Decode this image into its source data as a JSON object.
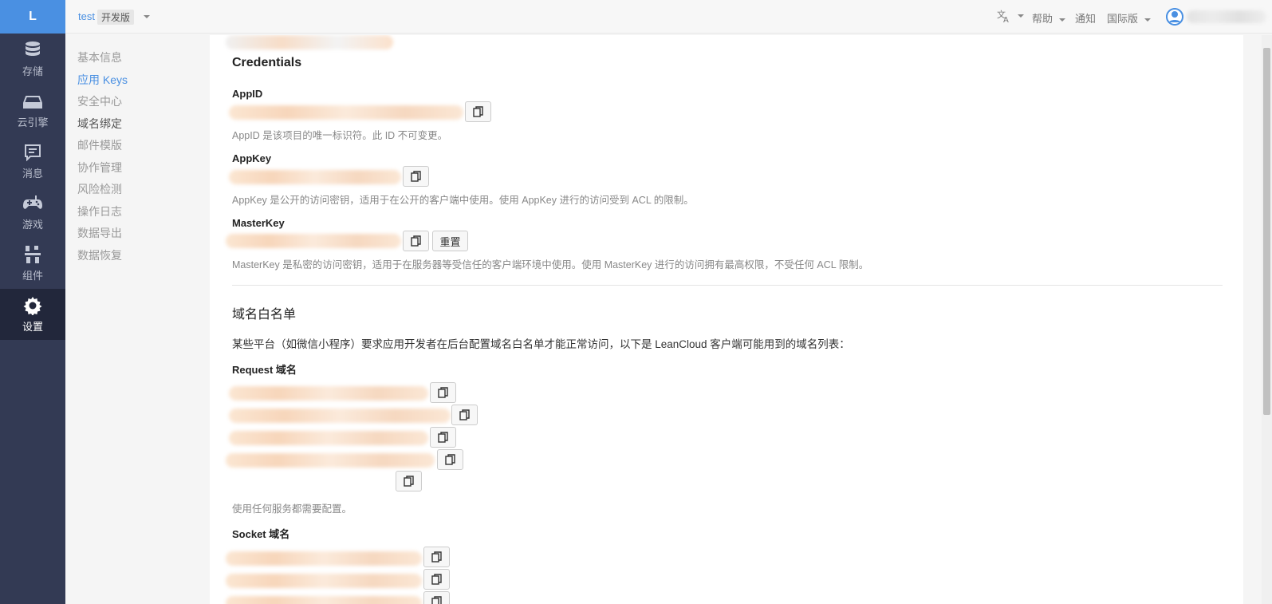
{
  "logo": {
    "letter": "L"
  },
  "nav": {
    "items": [
      {
        "label": "存储",
        "icon": "database-icon"
      },
      {
        "label": "云引擎",
        "icon": "server-icon"
      },
      {
        "label": "消息",
        "icon": "message-icon"
      },
      {
        "label": "游戏",
        "icon": "gamepad-icon"
      },
      {
        "label": "组件",
        "icon": "components-icon"
      },
      {
        "label": "设置",
        "icon": "gear-icon",
        "active": true
      }
    ]
  },
  "topbar": {
    "app_name": "test",
    "env": "开发版",
    "language_icon": "translate-icon",
    "help": "帮助",
    "notify": "通知",
    "region": "国际版"
  },
  "submenu": {
    "items": [
      {
        "label": "基本信息"
      },
      {
        "label": "应用 Keys",
        "active": true
      },
      {
        "label": "安全中心"
      },
      {
        "label": "域名绑定"
      },
      {
        "label": "邮件模版"
      },
      {
        "label": "协作管理"
      },
      {
        "label": "风险检测"
      },
      {
        "label": "操作日志"
      },
      {
        "label": "数据导出"
      },
      {
        "label": "数据恢复"
      }
    ]
  },
  "credentials": {
    "title": "Credentials",
    "appid": {
      "label": "AppID",
      "desc": "AppID 是该项目的唯一标识符。此 ID 不可变更。"
    },
    "appkey": {
      "label": "AppKey",
      "desc": "AppKey 是公开的访问密钥，适用于在公开的客户端中使用。使用 AppKey 进行的访问受到 ACL 的限制。"
    },
    "masterkey": {
      "label": "MasterKey",
      "reset": "重置",
      "desc": "MasterKey 是私密的访问密钥，适用于在服务器等受信任的客户端环境中使用。使用 MasterKey 进行的访问拥有最高权限，不受任何 ACL 限制。"
    }
  },
  "whitelist": {
    "title": "域名白名单",
    "intro": "某些平台（如微信小程序）要求应用开发者在后台配置域名白名单才能正常访问，以下是 LeanCloud 客户端可能用到的域名列表：",
    "request_label": "Request 域名",
    "request_note": "使用任何服务都需要配置。",
    "socket_label": "Socket 域名"
  },
  "colors": {
    "accent": "#4a90e2",
    "nav_bg": "#333a54",
    "nav_active": "#22273b"
  }
}
